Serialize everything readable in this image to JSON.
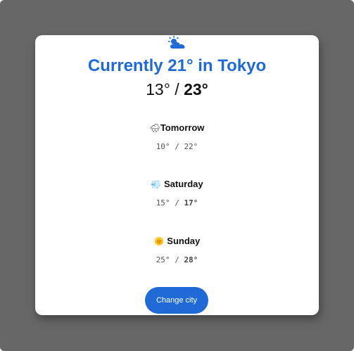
{
  "current": {
    "condition_icon": "sun-behind-cloud-icon",
    "headline": "Currently 21° in Tokyo",
    "low": "13°",
    "separator": "/",
    "high": "23°"
  },
  "forecast": [
    {
      "icon": "rain-cloud-icon",
      "emoji": "🌧",
      "day": "Tomorrow",
      "low": "10°",
      "separator": "/",
      "high": "22°"
    },
    {
      "icon": "wind-icon",
      "emoji": "💨",
      "day": "Saturday",
      "low": "15°",
      "separator": "/",
      "high": "17°"
    },
    {
      "icon": "sun-icon",
      "emoji": "🌞",
      "day": "Sunday",
      "low": "25°",
      "separator": "/",
      "high": "28°"
    }
  ],
  "actions": {
    "change_city_label": "Change city"
  },
  "colors": {
    "accent": "#1f6ad6",
    "backdrop": "#676767",
    "card": "#ffffff"
  }
}
